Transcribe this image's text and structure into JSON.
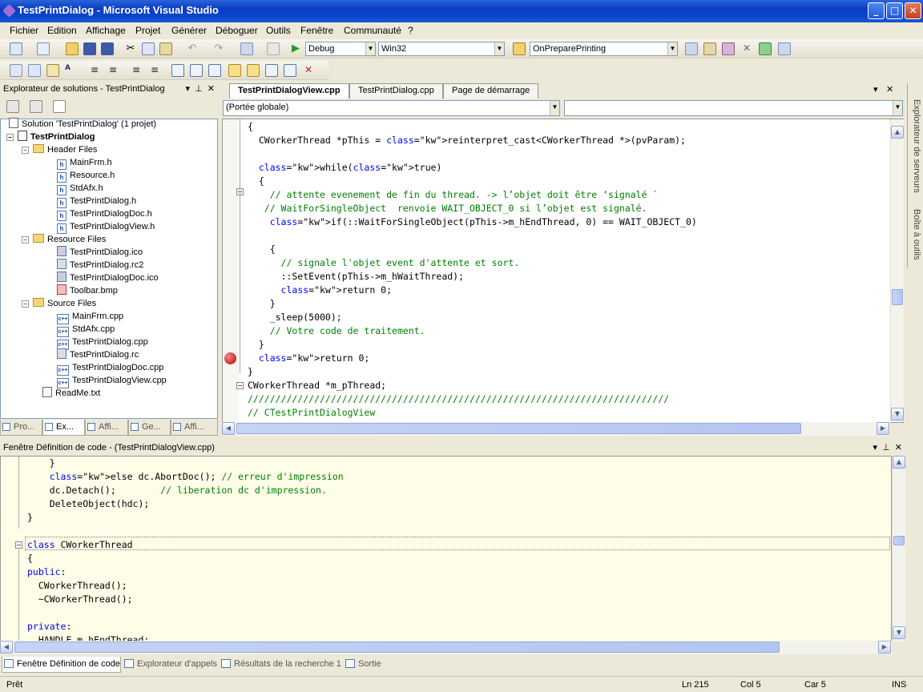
{
  "window": {
    "title": "TestPrintDialog - Microsoft Visual Studio"
  },
  "menu": [
    "Fichier",
    "Edition",
    "Affichage",
    "Projet",
    "Générer",
    "Déboguer",
    "Outils",
    "Fenêtre",
    "Communauté",
    "?"
  ],
  "toolbar": {
    "config": "Debug",
    "platform": "Win32",
    "function": "OnPreparePrinting"
  },
  "solution_explorer": {
    "title": "Explorateur de solutions - TestPrintDialog",
    "solution": "Solution 'TestPrintDialog' (1 projet)",
    "project": "TestPrintDialog",
    "folders": [
      {
        "name": "Header Files",
        "files": [
          "MainFrm.h",
          "Resource.h",
          "StdAfx.h",
          "TestPrintDialog.h",
          "TestPrintDialogDoc.h",
          "TestPrintDialogView.h"
        ]
      },
      {
        "name": "Resource Files",
        "files": [
          "TestPrintDialog.ico",
          "TestPrintDialog.rc2",
          "TestPrintDialogDoc.ico",
          "Toolbar.bmp"
        ]
      },
      {
        "name": "Source Files",
        "files": [
          "MainFrm.cpp",
          "StdAfx.cpp",
          "TestPrintDialog.cpp",
          "TestPrintDialog.rc",
          "TestPrintDialogDoc.cpp",
          "TestPrintDialogView.cpp"
        ]
      }
    ],
    "readme": "ReadMe.txt",
    "tabs": [
      "Pro...",
      "Ex...",
      "Affi...",
      "Ge...",
      "Affi..."
    ]
  },
  "editor": {
    "tabs": [
      "TestPrintDialogView.cpp",
      "TestPrintDialog.cpp",
      "Page de démarrage"
    ],
    "scope": "(Portée globale)",
    "lines": [
      "{",
      "  CWorkerThread *pThis = reinterpret_cast<CWorkerThread *>(pvParam);",
      "",
      "  while(true)",
      "  {",
      "    // attente evenement de fin du thread. -> l’objet doit être ‘signalé `",
      "   // WaitForSingleObject  renvoie WAIT_OBJECT_0 si l’objet est signalé.",
      "    if(::WaitForSingleObject(pThis->m_hEndThread, 0) == WAIT_OBJECT_0)",
      "",
      "    {",
      "      // signale l'objet event d'attente et sort.",
      "      ::SetEvent(pThis->m_hWaitThread);",
      "      return 0;",
      "    }",
      "    _sleep(5000);",
      "    // Votre code de traitement.",
      "  }",
      "  return 0;",
      "}",
      "CWorkerThread *m_pThread;",
      "////////////////////////////////////////////////////////////////////////////",
      "// CTestPrintDialogView"
    ]
  },
  "code_definition": {
    "title": "Fenêtre Définition de code - (TestPrintDialogView.cpp)",
    "lines": [
      "    }",
      "    else dc.AbortDoc(); // erreur d'impression",
      "    dc.Detach();        // liberation dc d'impression.",
      "    DeleteObject(hdc);",
      "}",
      "",
      "class CWorkerThread",
      "{",
      "public:",
      "  CWorkerThread();",
      "  ~CWorkerThread();",
      "",
      "private:",
      "  HANDLE m_hEndThread;"
    ]
  },
  "bottom_tabs": [
    "Fenêtre Définition de code",
    "Explorateur d'appels",
    "Résultats de la recherche 1",
    "Sortie"
  ],
  "right_tabs": [
    "Explorateur de serveurs",
    "Boîte à outils"
  ],
  "status": {
    "text": "Prêt",
    "line": "Ln 215",
    "col": "Col 5",
    "car": "Car 5",
    "mode": "INS"
  }
}
